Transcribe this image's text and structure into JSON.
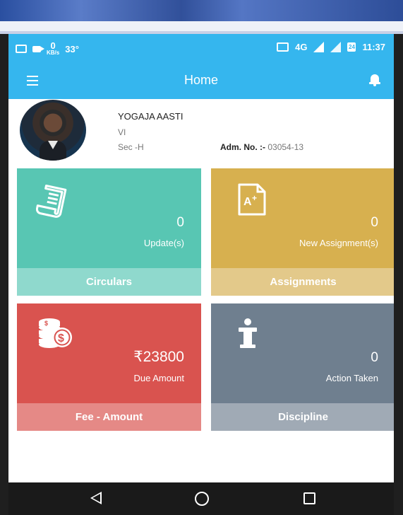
{
  "status_bar": {
    "net_speed": "0",
    "net_speed_unit": "KB/s",
    "temperature": "33°",
    "network": "4G",
    "time": "11:37",
    "calendar_day": "24"
  },
  "app_bar": {
    "title": "Home"
  },
  "profile": {
    "name": "YOGAJA AASTI",
    "class": "VI",
    "section": "Sec -H",
    "adm_label": "Adm. No. :-",
    "adm_value": "03054-13"
  },
  "tiles": [
    {
      "count": "0",
      "subtitle": "Update(s)",
      "footer": "Circulars",
      "icon": "document-icon",
      "color": "#58c6b3"
    },
    {
      "count": "0",
      "subtitle": "New Assignment(s)",
      "footer": "Assignments",
      "icon": "grade-paper-icon",
      "color": "#d7b04f"
    },
    {
      "count": "₹23800",
      "subtitle": "Due Amount",
      "footer": "Fee - Amount",
      "icon": "coins-icon",
      "color": "#d9534f"
    },
    {
      "count": "0",
      "subtitle": "Action Taken",
      "footer": "Discipline",
      "icon": "podium-icon",
      "color": "#6f7f8f"
    }
  ],
  "colors": {
    "accent": "#35b6ee"
  }
}
